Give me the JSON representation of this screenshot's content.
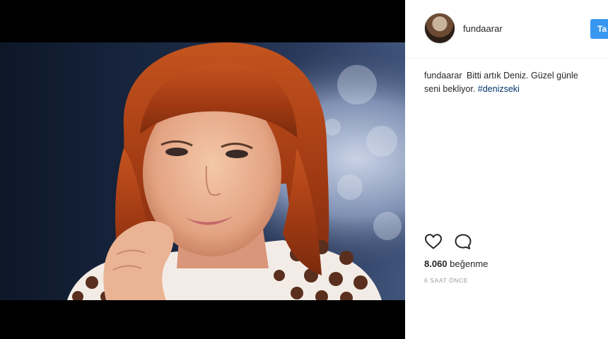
{
  "post": {
    "username": "fundaarar",
    "follow_label": "Ta",
    "caption": {
      "user": "fundaarar",
      "line1_text": "Bitti artık Deniz. Güzel günle",
      "line2_text": "seni bekliyor.",
      "hashtag": "#denizseki"
    },
    "likes_count": "8.060",
    "likes_label": "beğenme",
    "timestamp": "6 SAAT ÖNCE"
  },
  "icons": {
    "like": "heart-icon",
    "comment": "comment-icon"
  },
  "colors": {
    "follow_button": "#3897f0",
    "hashtag": "#003569",
    "media_background": "#000000"
  }
}
